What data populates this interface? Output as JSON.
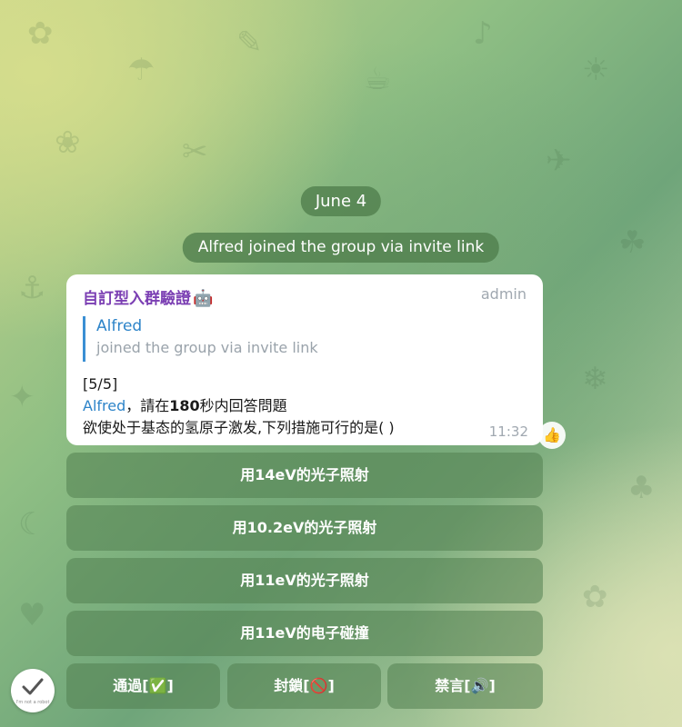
{
  "chat": {
    "date": "June 4",
    "service_message": "Alfred joined the group via invite link"
  },
  "message": {
    "sender": "自訂型入群驗證",
    "sender_emoji": "🤖",
    "admin_tag": "admin",
    "reply_name": "Alfred",
    "reply_text": "joined the group via invite link",
    "counter": "[5/5]",
    "mention": "Alfred",
    "prompt_prefix": "，請在",
    "prompt_seconds": "180",
    "prompt_suffix": "秒内回答問題",
    "question": "欲使处于基态的氢原子激发,下列措施可行的是(          )",
    "time": "11:32",
    "reaction": "👍"
  },
  "keyboard": {
    "answers": [
      "用14eV的光子照射",
      "用10.2eV的光子照射",
      "用11eV的光子照射",
      "用11eV的电子碰撞"
    ],
    "approve": "通過[✅]",
    "ban": "封鎖[🚫]",
    "mute": "禁言[🔊]"
  },
  "recaptcha": {
    "label": "I'm not a robot"
  },
  "colors": {
    "sender": "#7b3fb3",
    "link": "#2d84c9",
    "button_bg": "#528050"
  }
}
